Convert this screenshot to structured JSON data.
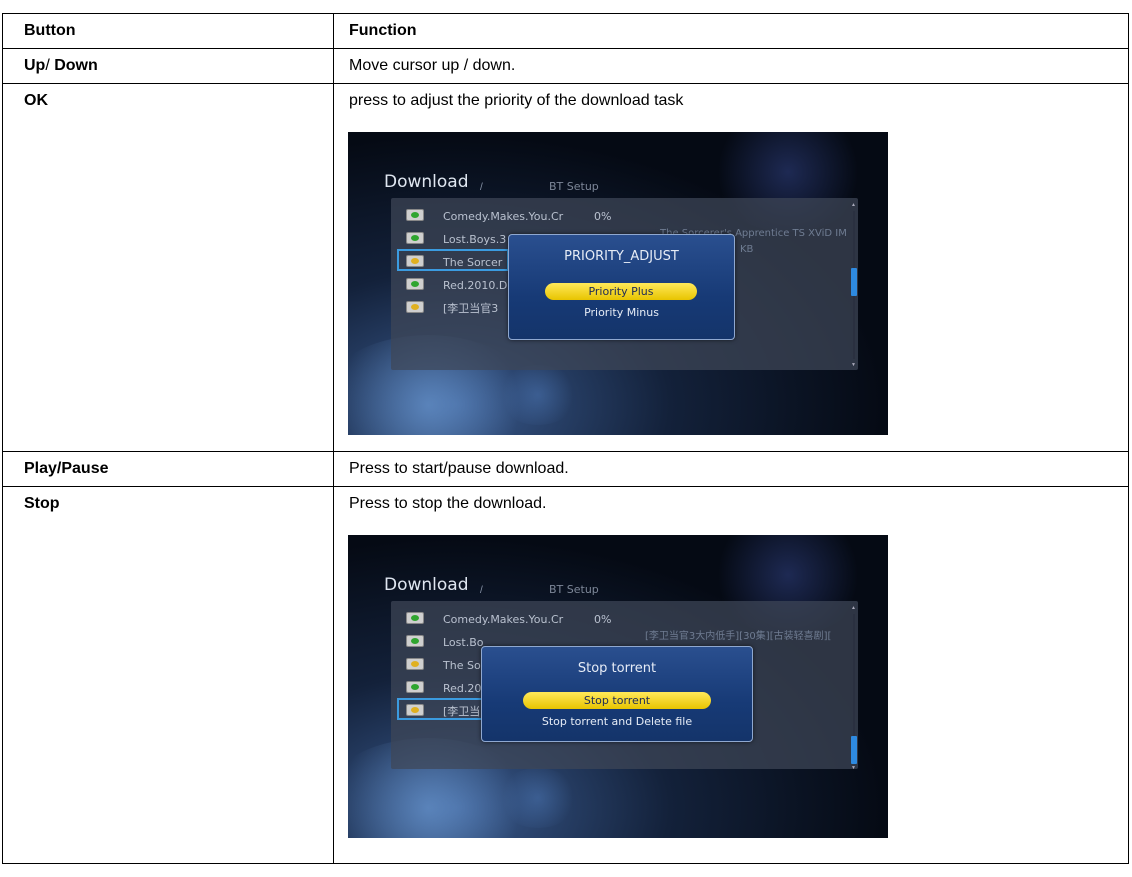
{
  "table": {
    "header": {
      "col1": "Button",
      "col2": "Function"
    },
    "rows": [
      {
        "button": "Up",
        "button_suffix": "/ ",
        "button_suffix2": "Down",
        "function": "Move cursor up / down."
      },
      {
        "button": "OK",
        "function": "press to adjust the priority of the download task"
      },
      {
        "button": "Play/Pause",
        "function": "Press to start/pause download."
      },
      {
        "button": "Stop",
        "function": "Press to stop the download."
      }
    ]
  },
  "screenshot1": {
    "title": "Download",
    "separator": "/",
    "tab": "BT Setup",
    "items": [
      {
        "label": "Comedy.Makes.You.Cr",
        "percent": "0%"
      },
      {
        "label": "Lost.Boys.3"
      },
      {
        "label": "The Sorcer"
      },
      {
        "label": "Red.2010.D"
      },
      {
        "label": "[李卫当官3"
      }
    ],
    "info_line1": "The Sorcerer's Apprentice TS XViD IM",
    "info_line2": "KB",
    "dialog": {
      "title": "PRIORITY_ADJUST",
      "options": [
        "Priority Plus",
        "Priority Minus"
      ]
    }
  },
  "screenshot2": {
    "title": "Download",
    "separator": "/",
    "tab": "BT Setup",
    "items": [
      {
        "label": "Comedy.Makes.You.Cr",
        "percent": "0%"
      },
      {
        "label": "Lost.Bo"
      },
      {
        "label": "The So"
      },
      {
        "label": "Red.20"
      },
      {
        "label": "[李卫当"
      }
    ],
    "info_line1": "[李卫当官3大内低手][30集][古装轻喜剧][",
    "dialog": {
      "title": "Stop torrent",
      "options": [
        "Stop torrent",
        "Stop torrent and Delete file"
      ]
    }
  }
}
